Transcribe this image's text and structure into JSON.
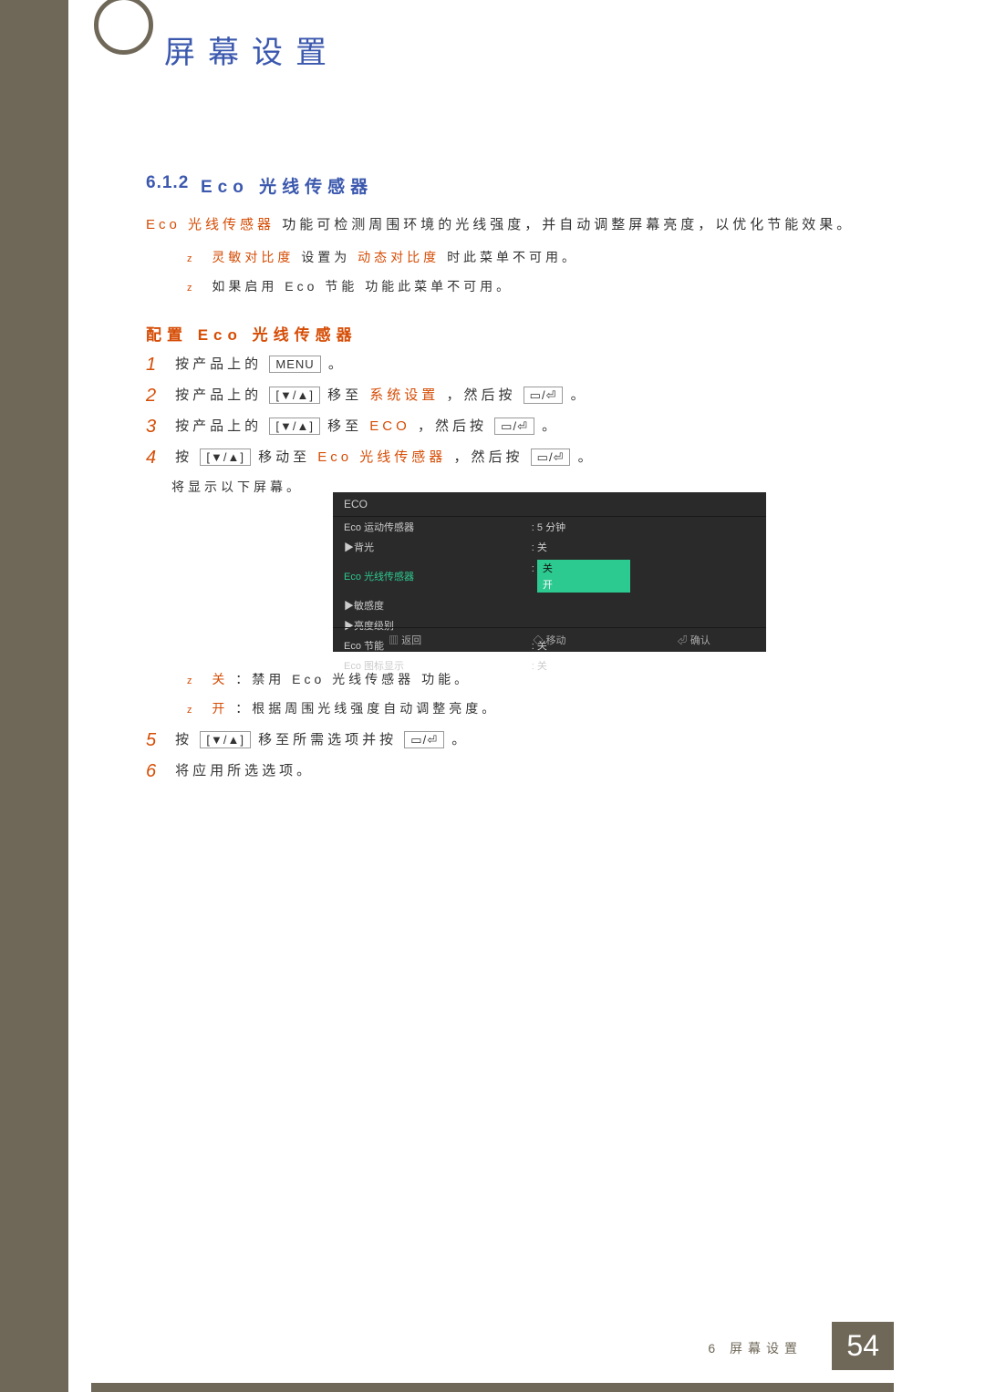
{
  "chapter": {
    "title": "屏幕设置"
  },
  "section": {
    "number": "6.1.2",
    "title": "Eco 光线传感器"
  },
  "description": {
    "highlight": "Eco 光线传感器",
    "text": "功能可检测周围环境的光线强度，并自动调整屏幕亮度，以优化节能效果。"
  },
  "bullets_top": [
    {
      "pre": "",
      "orange": "灵敏对比度",
      "mid": "设置为",
      "orange2": "动态对比度",
      "post": "时此菜单不可用。"
    },
    {
      "pre": "如果启用",
      "orange": "",
      "mid": "Eco 节能",
      "orange2": "",
      "post": "功能此菜单不可用。"
    }
  ],
  "subheading": "配置 Eco 光线传感器",
  "steps": [
    {
      "n": "1",
      "pre": "按产品上的",
      "btn": "MENU",
      "post": "。"
    },
    {
      "n": "2",
      "pre": "按产品上的",
      "arrows": "[▼/▲]",
      "mid": "移至",
      "orange": "系统设置",
      "post2": "，然后按",
      "iconend": true,
      "tail": "。"
    },
    {
      "n": "3",
      "pre": "按产品上的",
      "arrows": "[▼/▲]",
      "mid": "移至",
      "orange": "ECO",
      "post2": "，然后按",
      "iconend": true,
      "tail": "。"
    },
    {
      "n": "4",
      "pre": "按",
      "arrows": "[▼/▲]",
      "mid": "移动至",
      "orange": "Eco 光线传感器",
      "post2": "，然后按",
      "iconend": true,
      "tail": "。"
    }
  ],
  "step4_after": "将显示以下屏幕。",
  "osd": {
    "title": "ECO",
    "rows": [
      {
        "label": "Eco 运动传感器",
        "value": ": 5 分钟"
      },
      {
        "label": "▶背光",
        "value": ": 关"
      },
      {
        "label": "Eco 光线传感器",
        "value_sel1": "关",
        "value_sel2": "开",
        "highlight": true
      },
      {
        "label": "▶敏感度",
        "value": ""
      },
      {
        "label": "▶亮度级别",
        "value": ""
      },
      {
        "label": "Eco 节能",
        "value": ": 关"
      },
      {
        "label": "Eco 图标显示",
        "value": ": 关"
      }
    ],
    "footer": {
      "back": "返回",
      "move": "移动",
      "ok": "确认"
    }
  },
  "bullets_after": [
    {
      "orange": "关",
      "mid": "：禁用",
      "bold": "Eco 光线传感器",
      "post": "功能。"
    },
    {
      "orange": "开",
      "mid": "：根据周围光线强度自动调整亮度。",
      "bold": "",
      "post": ""
    }
  ],
  "steps2": [
    {
      "n": "5",
      "pre": "按",
      "arrows": "[▼/▲]",
      "mid": "移至所需选项并按",
      "iconend": true,
      "tail": "。"
    },
    {
      "n": "6",
      "pre": "将应用所选选项。"
    }
  ],
  "footer": {
    "text": "6 屏幕设置",
    "page": "54"
  }
}
